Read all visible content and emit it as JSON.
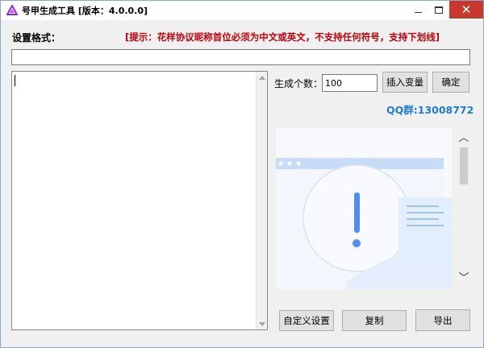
{
  "window": {
    "title": "号甲生成工具 [版本：4.0.0.0]",
    "close_glyph": "✕",
    "icon": "purple-triangle-app-icon"
  },
  "format": {
    "label": "设置格式：",
    "hint": "[提示：花样协议昵称首位必须为中文或英文，不支持任何符号，支持下划线]",
    "value": ""
  },
  "controls": {
    "count_label": "生成个数：",
    "count_value": "100",
    "insert_label": "插入变量",
    "ok_label": "确定",
    "qq": "QQ群:13008772"
  },
  "actions": {
    "custom_label": "自定义设置",
    "copy_label": "复制",
    "export_label": "导出"
  },
  "colors": {
    "hint": "#c0000a",
    "qq": "#1f7bd8",
    "close_button": "#c7382d"
  }
}
